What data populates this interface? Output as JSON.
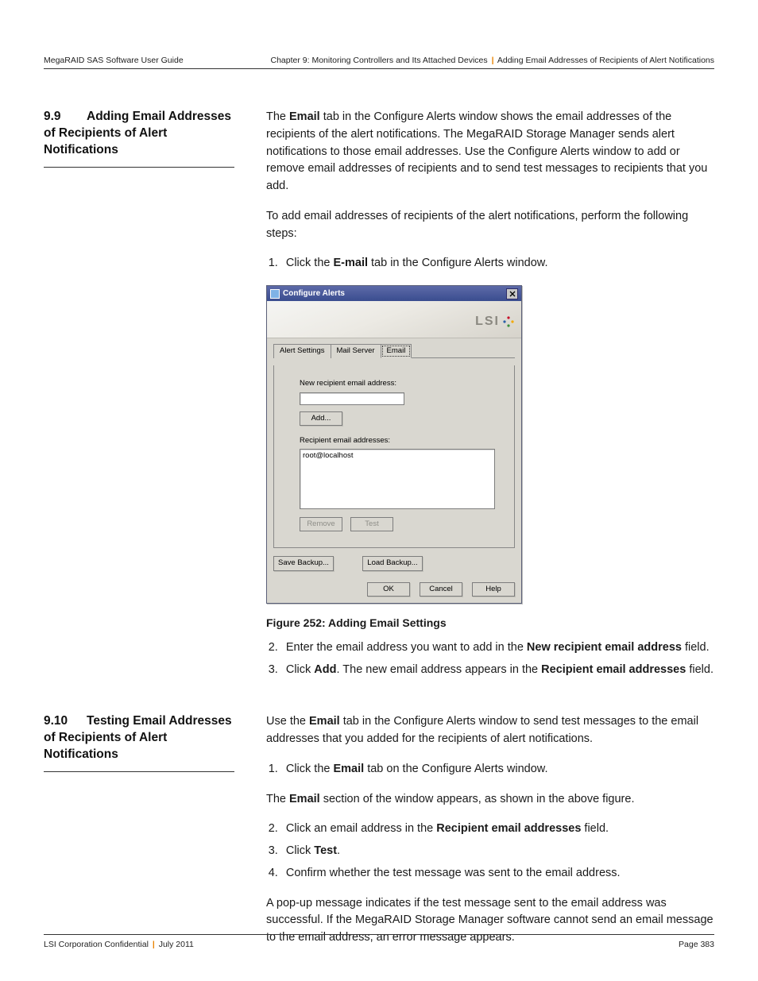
{
  "header": {
    "left": "MegaRAID SAS Software User Guide",
    "right_prefix": "Chapter 9: Monitoring Controllers and Its Attached Devices",
    "right_suffix": "Adding Email Addresses of Recipients of Alert Notifications"
  },
  "section99": {
    "num": "9.9",
    "title": "Adding Email Addresses of Recipients of Alert Notifications",
    "p1_a": "The ",
    "p1_b": "Email",
    "p1_c": " tab in the Configure Alerts window shows the email addresses of the recipients of the alert notifications. The MegaRAID Storage Manager             sends alert notifications to those email addresses. Use the Configure Alerts window to add or remove email addresses of recipients and to send test messages to recipients that you add.",
    "p2": "To add email addresses of recipients of the alert notifications, perform the following steps:",
    "step1_a": "Click the ",
    "step1_b": "E-mail",
    "step1_c": " tab in the Configure Alerts window.",
    "figcap": "Figure 252:    Adding Email Settings",
    "step2_a": "Enter the email address you want to add in the ",
    "step2_b": "New recipient email address",
    "step2_c": " field.",
    "step3_a": "Click ",
    "step3_b": "Add",
    "step3_c": ". The new email address appears in the ",
    "step3_d": "Recipient email addresses",
    "step3_e": " field."
  },
  "section910": {
    "num": "9.10",
    "title": "Testing Email Addresses of Recipients of Alert Notifications",
    "p1_a": "Use the ",
    "p1_b": "Email",
    "p1_c": " tab in the Configure Alerts window to send test messages to the email addresses that you added for the recipients of alert notifications.",
    "s1_a": "Click the ",
    "s1_b": "Email",
    "s1_c": " tab on the Configure Alerts window.",
    "p2_a": "The ",
    "p2_b": "Email",
    "p2_c": " section of the window appears, as shown in the above figure.",
    "s2_a": "Click an email address in the ",
    "s2_b": "Recipient email addresses",
    "s2_c": " field.",
    "s3_a": "Click ",
    "s3_b": "Test",
    "s3_c": ".",
    "s4": "Confirm whether the test message was sent to the email address.",
    "p3": "A pop-up message indicates if the test message sent to the email address was successful. If the MegaRAID Storage Manager software cannot send an email message to the email address, an error message appears."
  },
  "dialog": {
    "title": "Configure Alerts",
    "logo": "LSI",
    "tabs": {
      "t1": "Alert Settings",
      "t2": "Mail Server",
      "t3": "Email"
    },
    "lbl_new": "New recipient email address:",
    "btn_add": "Add...",
    "lbl_rec": "Recipient email addresses:",
    "entry": "root@localhost",
    "btn_remove": "Remove",
    "btn_test": "Test",
    "btn_saveb": "Save Backup...",
    "btn_loadb": "Load Backup...",
    "btn_ok": "OK",
    "btn_cancel": "Cancel",
    "btn_help": "Help"
  },
  "footer": {
    "left_a": "LSI Corporation Confidential",
    "left_b": "July 2011",
    "right": "Page 383"
  }
}
